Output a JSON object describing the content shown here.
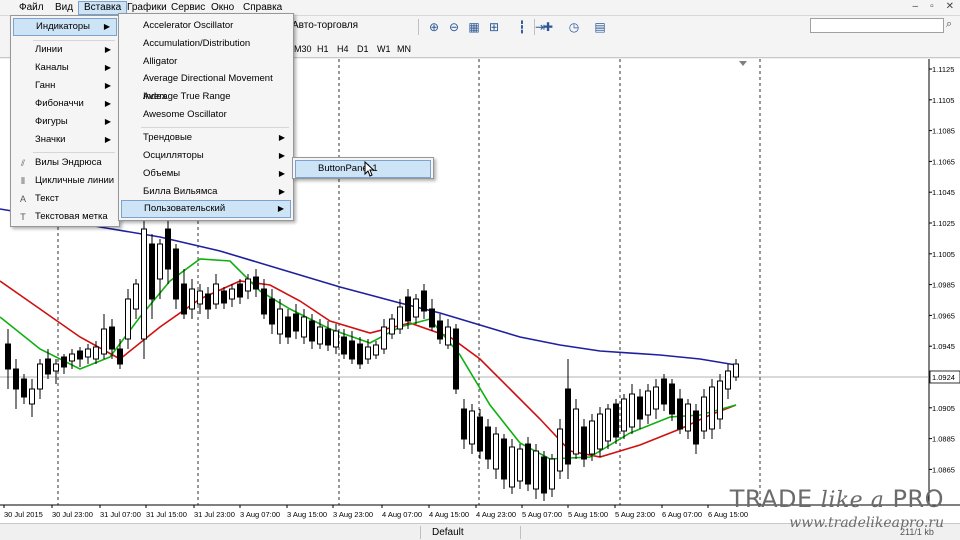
{
  "menubar": {
    "items": [
      "Файл",
      "Вид",
      "Вставка",
      "Графики",
      "Сервис",
      "Окно",
      "Справка"
    ],
    "active_index": 2
  },
  "toolbar": {
    "algo_trading_label": "Авто-торговля"
  },
  "timeframes": [
    "M30",
    "H1",
    "H4",
    "D1",
    "W1",
    "MN"
  ],
  "insert_menu": {
    "items": [
      {
        "label": "Индикаторы",
        "submenu": true,
        "icon": ""
      },
      {
        "label": "Линии",
        "submenu": true,
        "icon": ""
      },
      {
        "label": "Каналы",
        "submenu": true,
        "icon": ""
      },
      {
        "label": "Ганн",
        "submenu": true,
        "icon": ""
      },
      {
        "label": "Фибоначчи",
        "submenu": true,
        "icon": ""
      },
      {
        "label": "Фигуры",
        "submenu": true,
        "icon": ""
      },
      {
        "label": "Значки",
        "submenu": true,
        "icon": ""
      },
      {
        "label": "Вилы Эндрюса",
        "submenu": false,
        "icon": "andrews-pitchfork-icon"
      },
      {
        "label": "Цикличные линии",
        "submenu": false,
        "icon": "cycle-lines-icon"
      },
      {
        "label": "Текст",
        "submenu": false,
        "icon": "text-icon"
      },
      {
        "label": "Текстовая метка",
        "submenu": false,
        "icon": "text-label-icon"
      }
    ]
  },
  "indicators_menu": {
    "items": [
      {
        "label": "Accelerator Oscillator",
        "submenu": false
      },
      {
        "label": "Accumulation/Distribution",
        "submenu": false
      },
      {
        "label": "Alligator",
        "submenu": false
      },
      {
        "label": "Average Directional Movement Index",
        "submenu": false
      },
      {
        "label": "Average True Range",
        "submenu": false
      },
      {
        "label": "Awesome Oscillator",
        "submenu": false
      },
      {
        "label": "Трендовые",
        "submenu": true
      },
      {
        "label": "Осцилляторы",
        "submenu": true
      },
      {
        "label": "Объемы",
        "submenu": true
      },
      {
        "label": "Билла Вильямса",
        "submenu": true
      },
      {
        "label": "Пользовательский",
        "submenu": true
      }
    ]
  },
  "custom_menu": {
    "items": [
      {
        "label": "ButtonPanel 1"
      }
    ]
  },
  "price_axis": {
    "labels": [
      "1.1125",
      "1.1105",
      "1.1085",
      "1.1065",
      "1.1045",
      "1.1025",
      "1.1005",
      "1.0985",
      "1.0965",
      "1.0945",
      "1.0924",
      "1.0905",
      "1.0885",
      "1.0865"
    ],
    "current_price": "1.0924"
  },
  "time_axis": {
    "labels": [
      "30 Jul 2015",
      "30 Jul 23:00",
      "31 Jul 07:00",
      "31 Jul 15:00",
      "31 Jul 23:00",
      "3 Aug 07:00",
      "3 Aug 15:00",
      "3 Aug 23:00",
      "4 Aug 07:00",
      "4 Aug 15:00",
      "4 Aug 23:00",
      "5 Aug 07:00",
      "5 Aug 15:00",
      "5 Aug 23:00",
      "6 Aug 07:00",
      "6 Aug 15:00"
    ]
  },
  "statusbar": {
    "profile": "Default",
    "traffic": "211/1 kb"
  },
  "watermark": {
    "logo_a": "TRADE ",
    "logo_b": "like a",
    "logo_c": " PRO",
    "url": "www.tradelikeapro.ru"
  },
  "colors": {
    "ma_slow": "#1f1fa0",
    "ma_mid": "#d01010",
    "ma_fast": "#10b010",
    "candle": "#000000",
    "menu_highlight": "#cde4f7"
  }
}
